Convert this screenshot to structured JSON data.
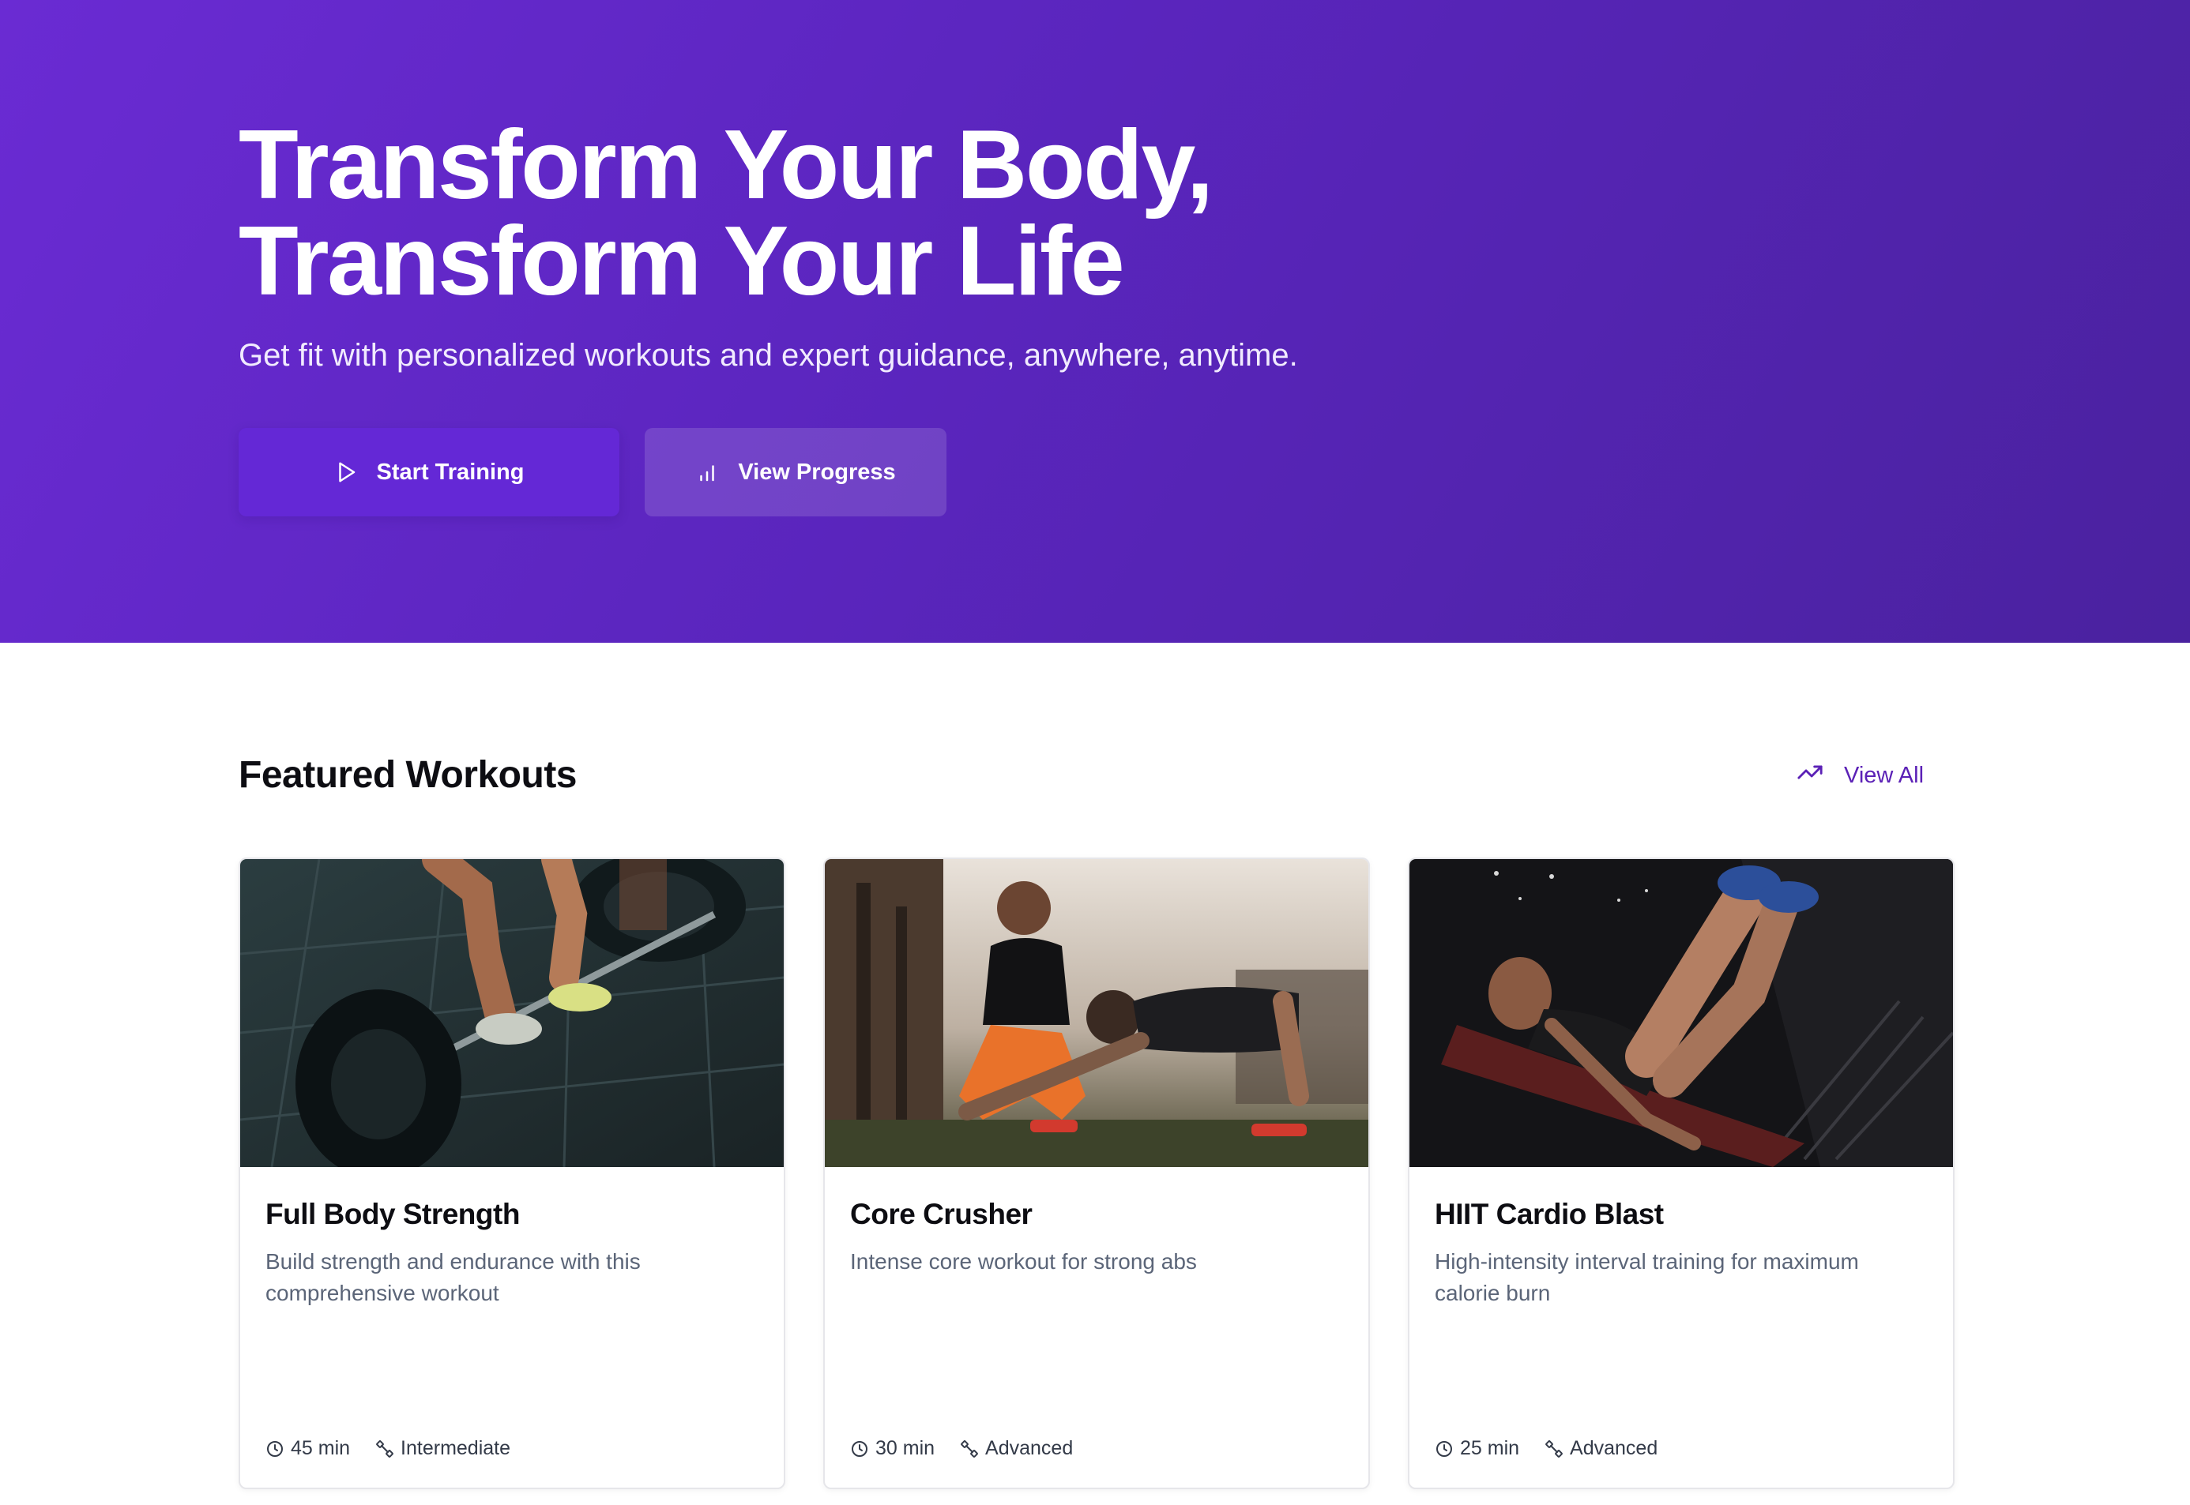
{
  "hero": {
    "title_line1": "Transform Your Body,",
    "title_line2": "Transform Your Life",
    "subtitle": "Get fit with personalized workouts and expert guidance, anywhere, anytime.",
    "primary_button": {
      "label": "Start Training",
      "icon": "play-icon"
    },
    "secondary_button": {
      "label": "View Progress",
      "icon": "bar-chart-icon"
    }
  },
  "featured": {
    "title": "Featured Workouts",
    "view_all": {
      "label": "View All",
      "icon": "trending-up-icon"
    },
    "workouts": [
      {
        "title": "Full Body Strength",
        "description": "Build strength and endurance with this comprehensive workout",
        "duration": "45 min",
        "level": "Intermediate",
        "image": "barbell-deadlift-photo"
      },
      {
        "title": "Core Crusher",
        "description": "Intense core workout for strong abs",
        "duration": "30 min",
        "level": "Advanced",
        "image": "trainer-pushup-photo"
      },
      {
        "title": "HIIT Cardio Blast",
        "description": "High-intensity interval training for maximum calorie burn",
        "duration": "25 min",
        "level": "Advanced",
        "image": "leg-press-photo"
      }
    ]
  },
  "colors": {
    "hero_gradient_start": "#6a2bd3",
    "hero_gradient_end": "#4a229f",
    "accent": "#5b21b6",
    "primary_button": "#6428d6"
  }
}
